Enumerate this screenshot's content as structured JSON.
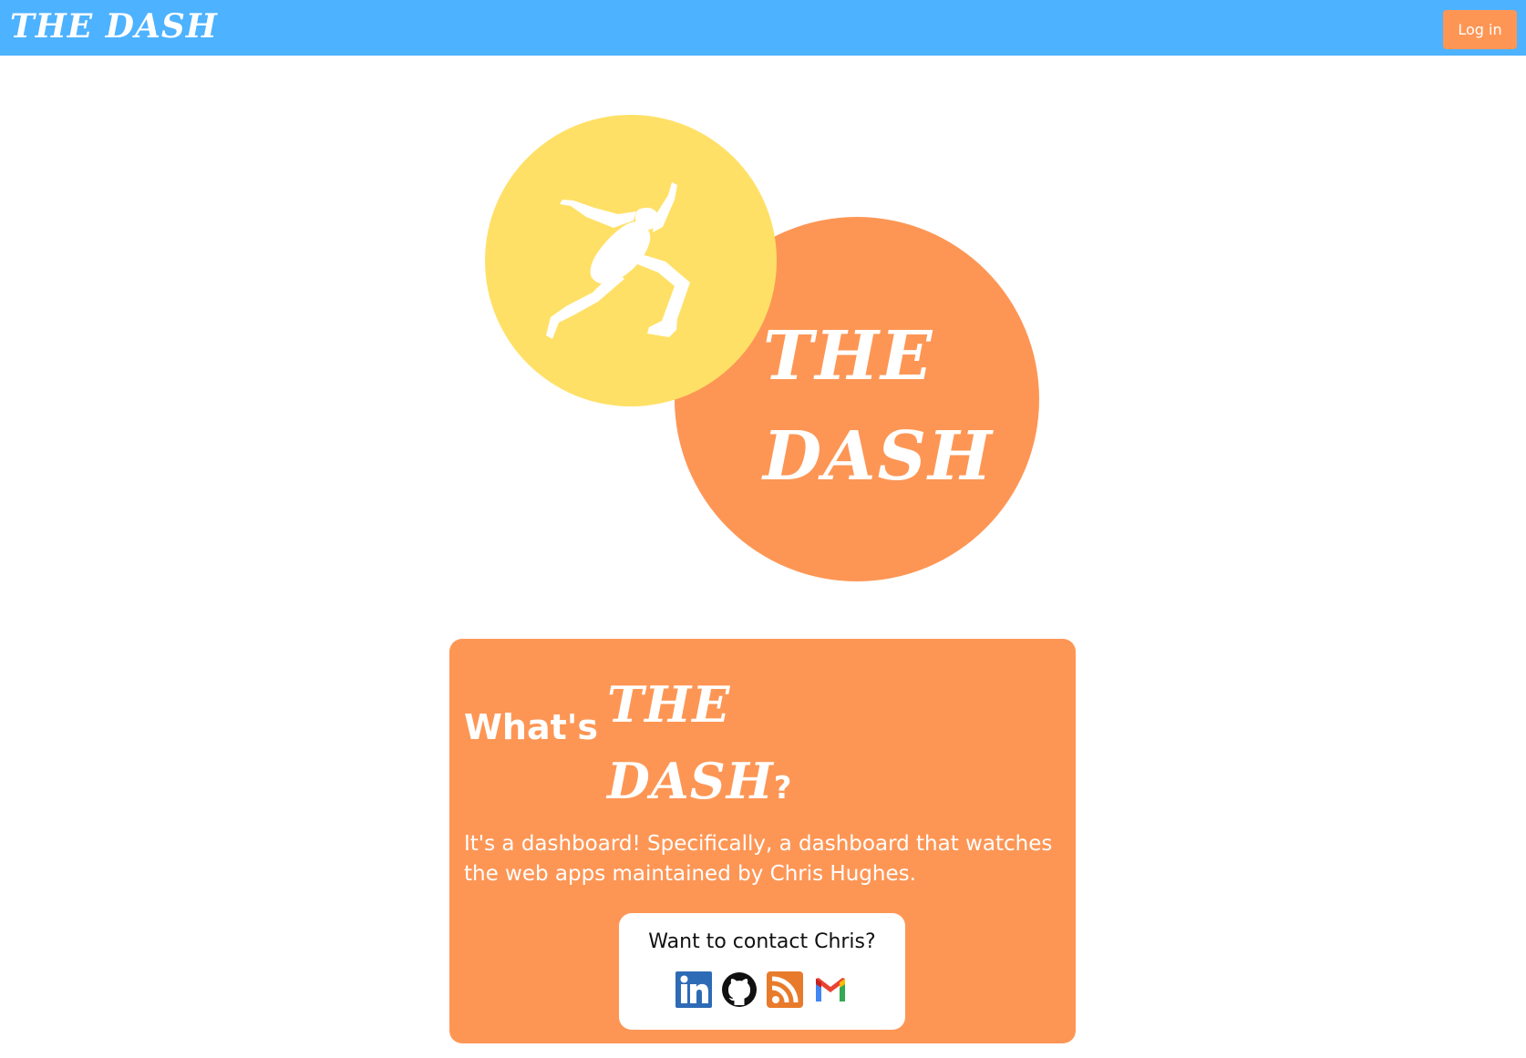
{
  "header": {
    "brand": "THE DASH",
    "login_label": "Log in"
  },
  "hero": {
    "title_line1": "THE",
    "title_line2": "DASH",
    "icon": "runner-icon"
  },
  "intro": {
    "heading_prefix": "What's",
    "heading_logo_line1": "THE",
    "heading_logo_line2": "DASH",
    "heading_suffix": "?",
    "description": "It's a dashboard! Specifically, a dashboard that watches the web apps maintained by Chris Hughes."
  },
  "contact": {
    "title": "Want to contact Chris?",
    "links": [
      {
        "icon": "linkedin-icon"
      },
      {
        "icon": "github-icon"
      },
      {
        "icon": "rss-icon"
      },
      {
        "icon": "gmail-icon"
      }
    ]
  },
  "colors": {
    "header": "#4db2ff",
    "accent_orange": "#fd9655",
    "accent_yellow": "#ffe066",
    "text_light": "#ffffff"
  }
}
